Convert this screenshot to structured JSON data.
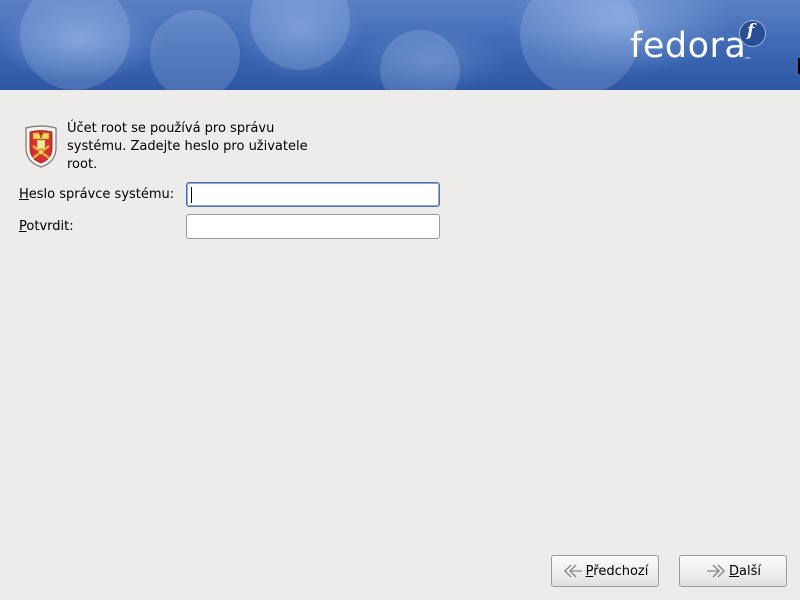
{
  "header": {
    "logo_text": "fedora",
    "logo_mark": "f",
    "logo_tm": "™"
  },
  "intro": {
    "icon": "root-shield-icon",
    "text": "Účet root se používá pro správu systému. Zadejte heslo pro uživatele root."
  },
  "form": {
    "password": {
      "label_mnemonic": "H",
      "label_rest": "eslo správce systému:",
      "value": ""
    },
    "confirm": {
      "label_mnemonic": "P",
      "label_rest": "otvrdit:",
      "value": ""
    }
  },
  "buttons": {
    "back": {
      "mnemonic": "P",
      "rest": "ředchozí",
      "icon": "arrow-back-icon"
    },
    "next": {
      "mnemonic": "D",
      "rest": "alší",
      "icon": "arrow-forward-icon"
    }
  },
  "colors": {
    "banner": "#3d67b3",
    "background": "#edeceb",
    "focus_border": "#4f6fa8"
  }
}
